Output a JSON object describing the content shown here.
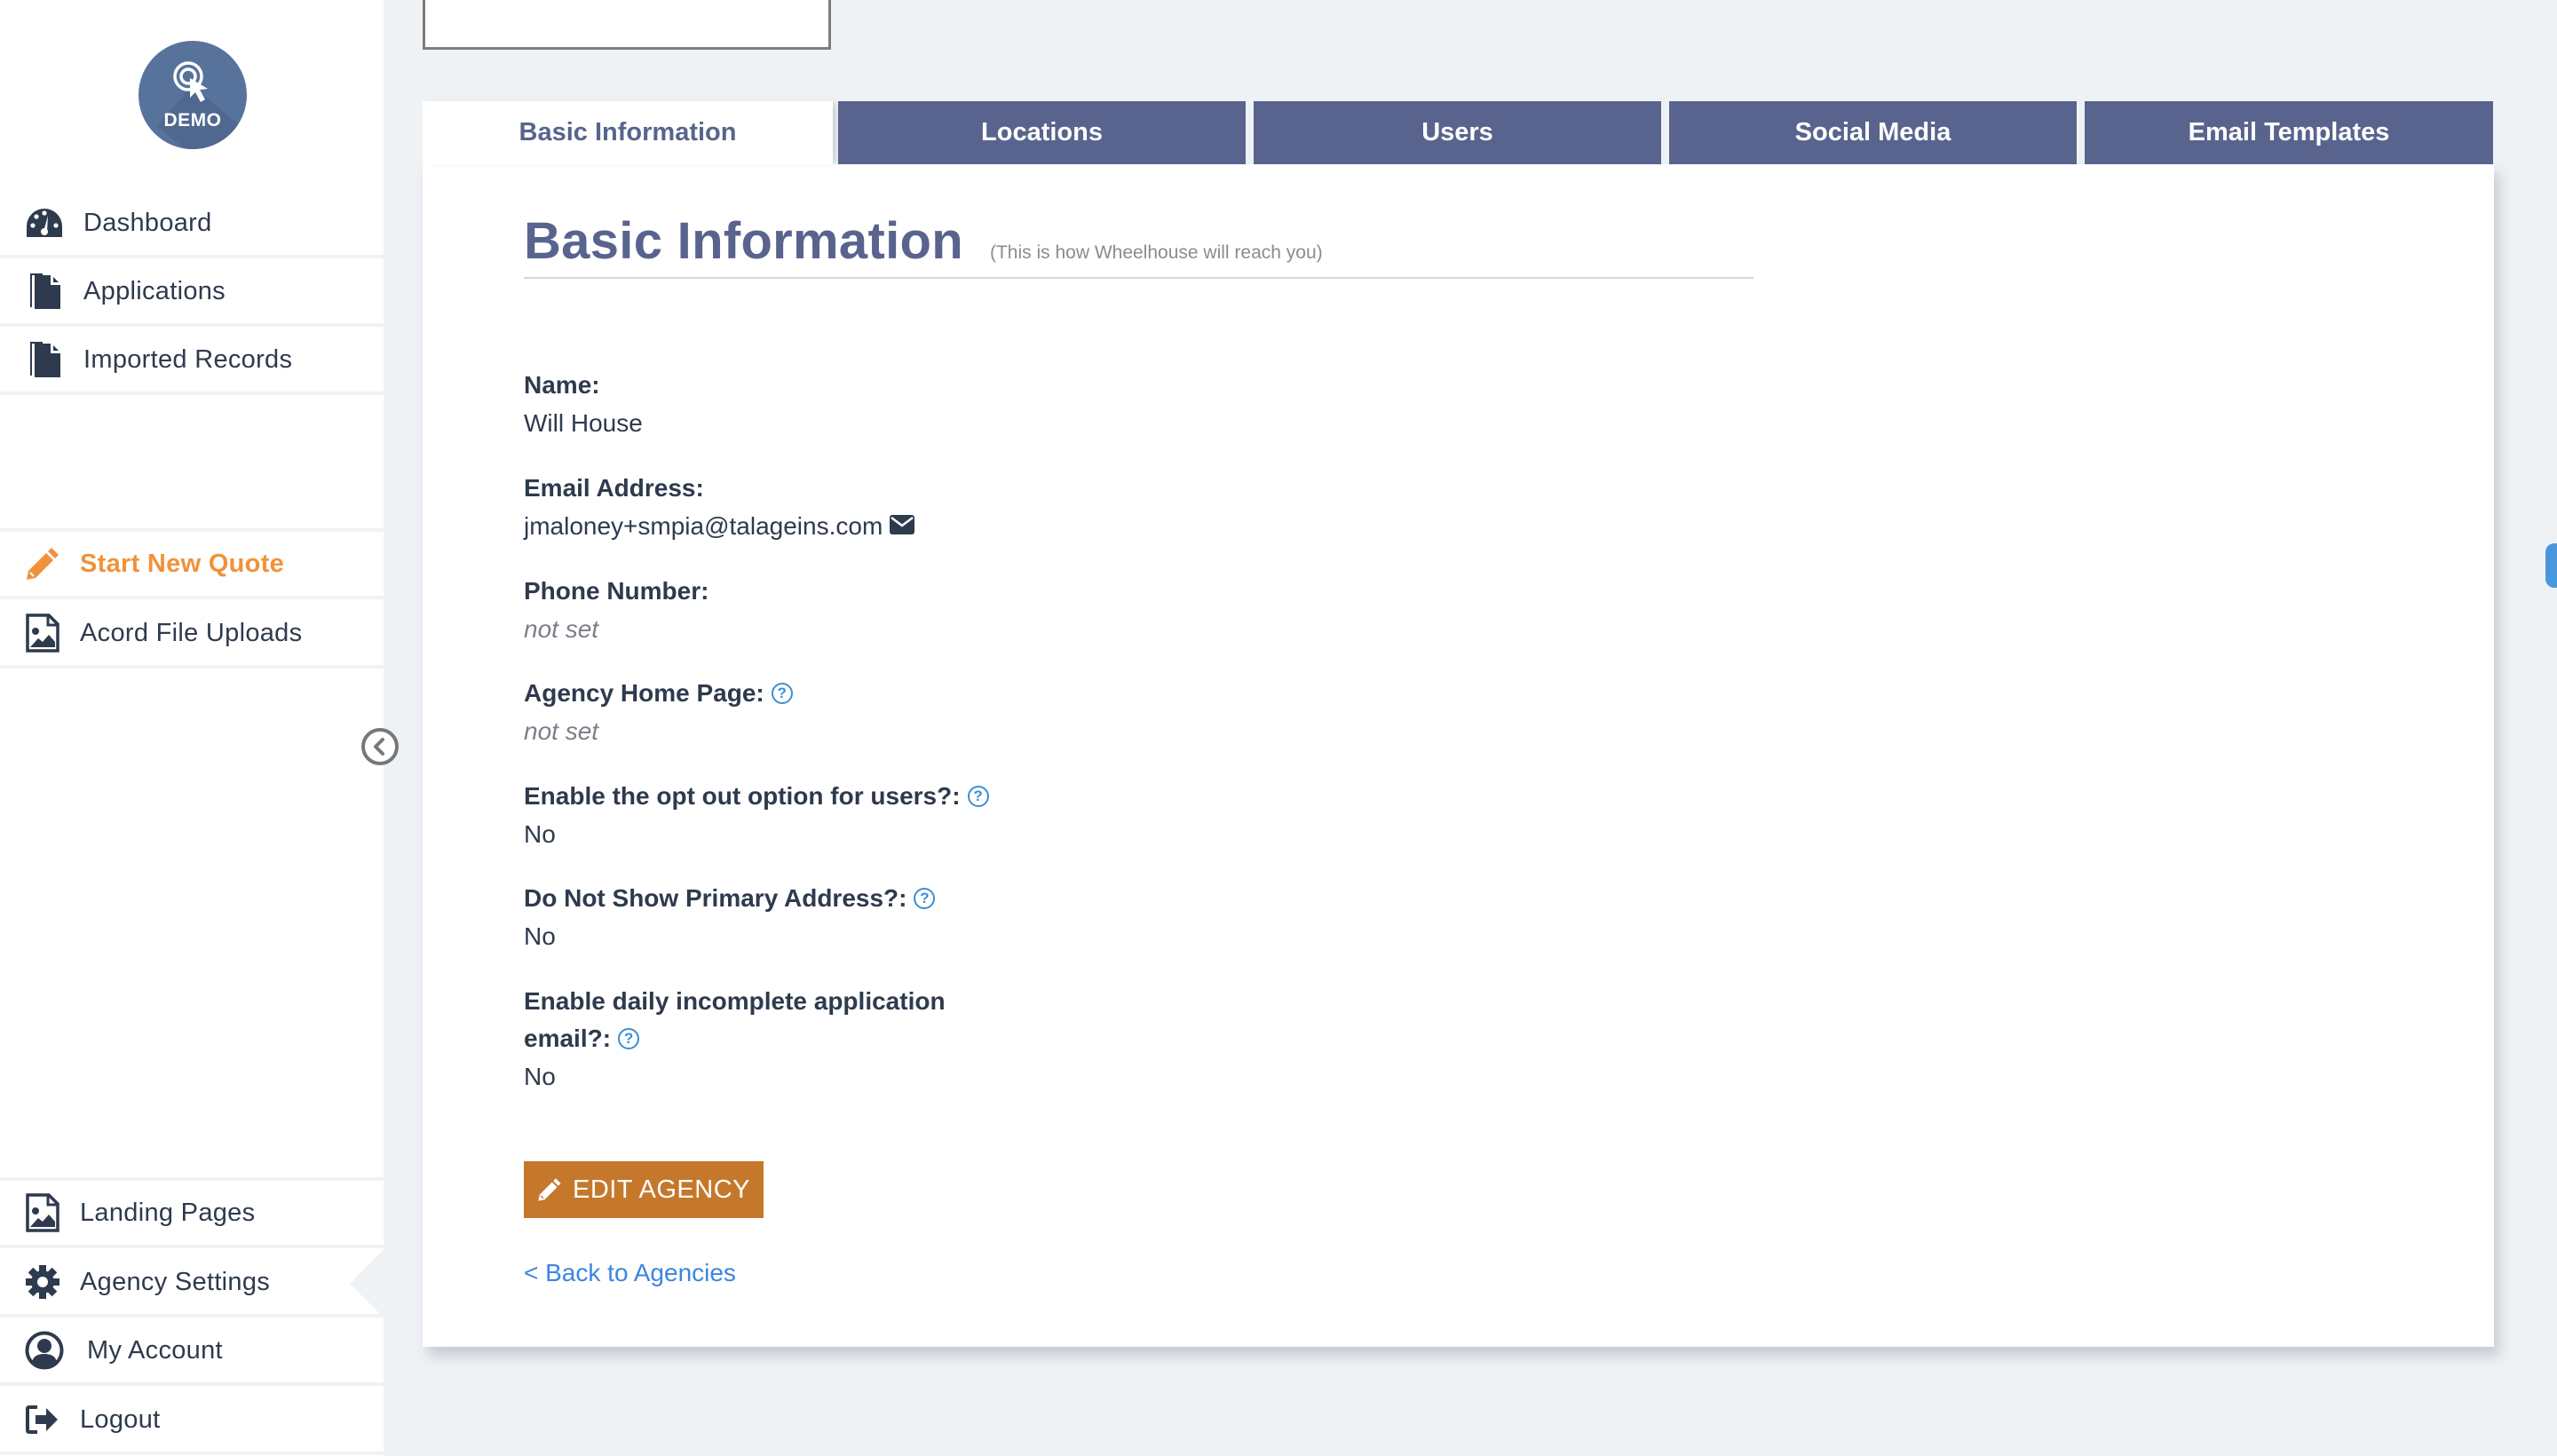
{
  "brand": {
    "logo_text": "DEMO",
    "logo_color": "#58739b"
  },
  "sidebar": {
    "top_items": [
      {
        "label": "Dashboard",
        "icon": "dashboard-gauge-icon"
      },
      {
        "label": "Applications",
        "icon": "files-icon"
      },
      {
        "label": "Imported Records",
        "icon": "files-icon"
      }
    ],
    "mid_items": [
      {
        "label": "Start New Quote",
        "icon": "pencil-icon",
        "color": "#f0923a"
      },
      {
        "label": "Acord File Uploads",
        "icon": "image-file-icon"
      }
    ],
    "bottom_items": [
      {
        "label": "Landing Pages",
        "icon": "image-file-icon"
      },
      {
        "label": "Agency Settings",
        "icon": "gear-icon",
        "active": true
      },
      {
        "label": "My Account",
        "icon": "user-circle-icon"
      },
      {
        "label": "Logout",
        "icon": "logout-icon"
      }
    ],
    "collapse_icon": "chevron-left-circle-icon"
  },
  "tabs": [
    {
      "label": "Basic Information",
      "active": true
    },
    {
      "label": "Locations"
    },
    {
      "label": "Users"
    },
    {
      "label": "Social Media"
    },
    {
      "label": "Email Templates"
    }
  ],
  "main": {
    "heading": "Basic Information",
    "subheading": "(This is how Wheelhouse will reach you)",
    "fields": [
      {
        "label": "Name:",
        "value": "Will House"
      },
      {
        "label": "Email Address:",
        "value": "jmaloney+smpia@talageins.com"
      },
      {
        "label": "Phone Number:",
        "value": "not set"
      },
      {
        "label": "Agency Home Page:",
        "value": "not set"
      },
      {
        "label": "Enable the opt out option for users?:",
        "value": "No"
      },
      {
        "label": "Do Not Show Primary Address?:",
        "value": "No"
      },
      {
        "label_line1": "Enable daily incomplete application",
        "label_line2": "email?:",
        "value": "No"
      }
    ],
    "edit_button": "EDIT AGENCY",
    "back_link": "< Back to Agencies"
  },
  "colors": {
    "tab": "#58648d",
    "accent_orange": "#f0923a",
    "button_orange": "#c5782c",
    "link_blue": "#3a86e0",
    "help_blue": "#3a8fd4",
    "background": "#eff2f5"
  }
}
